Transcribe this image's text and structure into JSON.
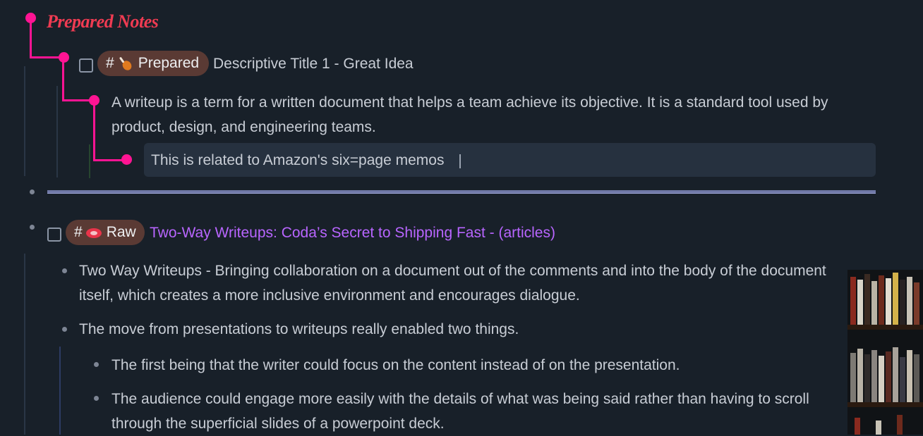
{
  "section": {
    "title": "Prepared Notes"
  },
  "prepared_item": {
    "tag_hash": "#",
    "tag_icon": "drumstick-icon",
    "tag_label": "Prepared",
    "title": "Descriptive Title 1 - Great Idea",
    "child_text_line1": "A writeup is a term for a written document that helps a team achieve its objective. It is a standard tool used by",
    "child_text_line2": "product, design, and engineering teams.",
    "grandchild_text": "This is related to Amazon's six=page memos"
  },
  "raw_item": {
    "tag_hash": "#",
    "tag_icon": "raw-steak-icon",
    "tag_label": "Raw",
    "title_link": "Two-Way Writeups: Coda’s Secret to Shipping Fast - (articles)",
    "bullets": [
      {
        "line1": "Two Way Writeups - Bringing collaboration on a document out of the comments and into the body of the document",
        "line2": "itself, which creates a more inclusive environment and encourages dialogue."
      },
      {
        "line1": "The move from presentations to writeups really enabled two things."
      }
    ],
    "sub_bullets": [
      {
        "line1": "The first being that the writer could focus on the content instead of on the presentation."
      },
      {
        "line1": "The audience could engage more easily with the details of what was being said rather than having to scroll",
        "line2": "through the superficial slides of a powerpoint deck."
      }
    ]
  },
  "colors": {
    "background": "#182029",
    "accent_pink": "#ff1493",
    "title_red": "#ef3b52",
    "link_purple": "#b865ff",
    "tag_bg": "#5a3a34"
  }
}
